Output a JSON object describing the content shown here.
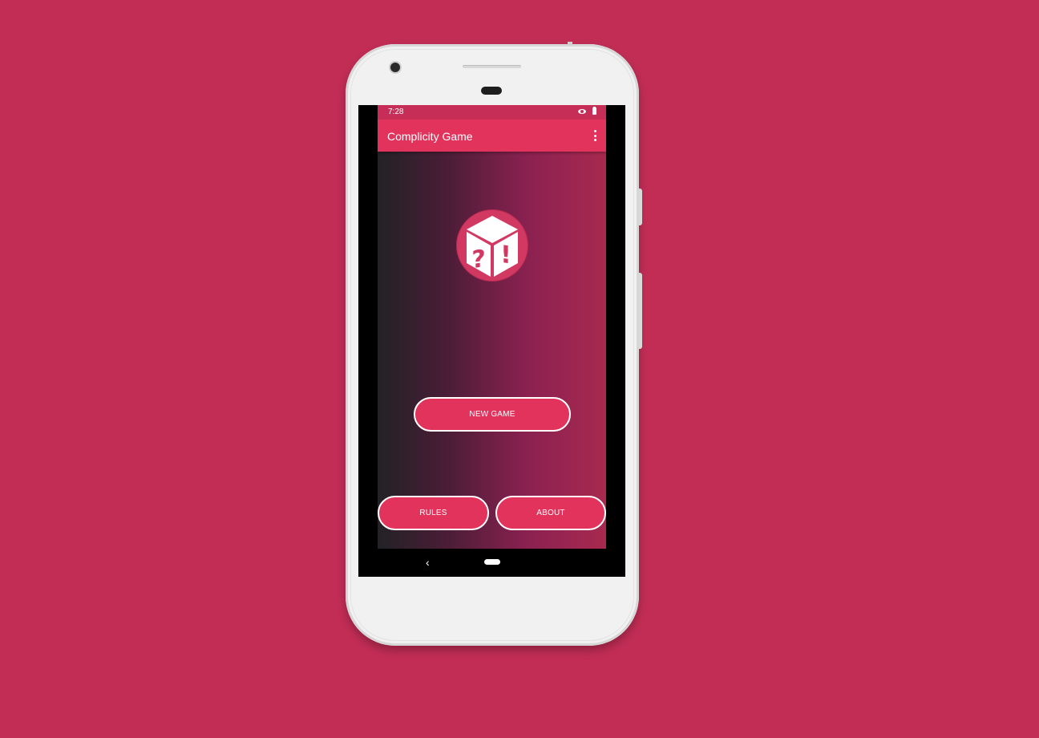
{
  "background_color": "#c12d55",
  "accent_color": "#e1335c",
  "statusbar": {
    "time": "7:28",
    "icons": [
      "eye-icon",
      "battery-icon"
    ]
  },
  "appbar": {
    "title": "Complicity Game",
    "menu_icon": "kebab-icon"
  },
  "main": {
    "logo_icon": "dice-question-exclamation-icon",
    "new_game_label": "NEW GAME",
    "rules_label": "RULES",
    "about_label": "ABOUT"
  },
  "navbar": {
    "back_icon": "back-icon",
    "home_icon": "home-icon"
  }
}
